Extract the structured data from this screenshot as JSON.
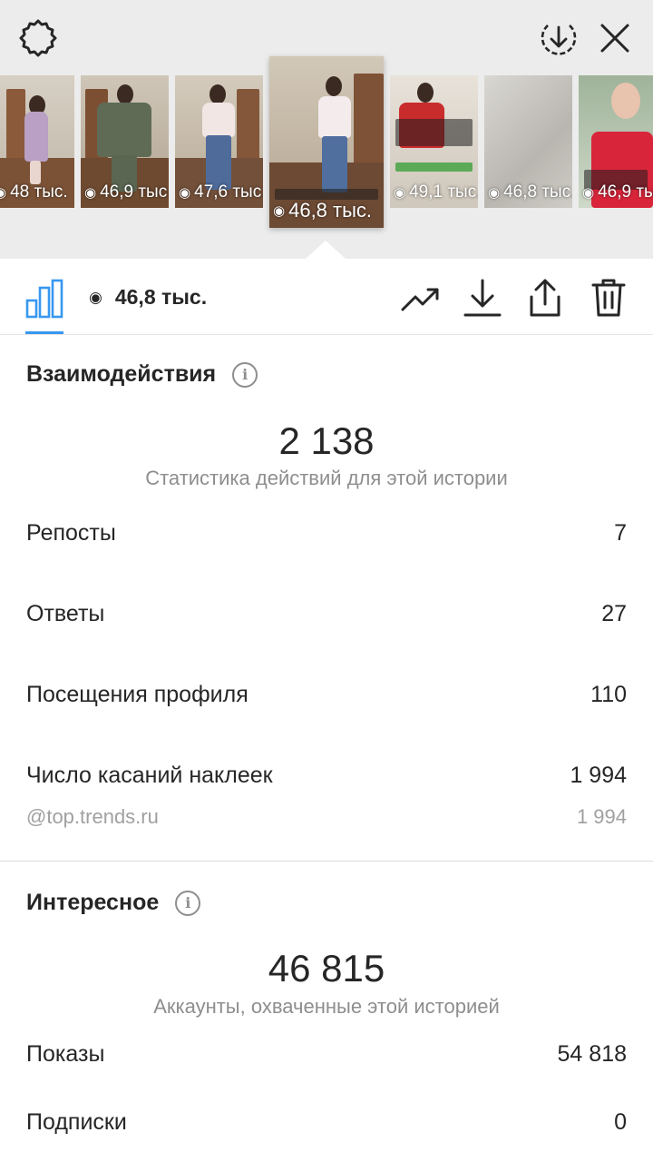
{
  "header": {
    "icons": [
      "settings-icon",
      "download-circle-icon",
      "close-icon"
    ]
  },
  "stories": [
    {
      "views": "48 тыс."
    },
    {
      "views": "46,9 тыс."
    },
    {
      "views": "47,6 тыс."
    },
    {
      "views": "46,8 тыс.",
      "selected": true
    },
    {
      "views": "49,1 тыс."
    },
    {
      "views": "46,8 тыс."
    },
    {
      "views": "46,9 тыс."
    }
  ],
  "toolbar": {
    "views": "46,8 тыс.",
    "accent": "#3897f0"
  },
  "interactions": {
    "title": "Взаимодействия",
    "total": "2 138",
    "subtitle": "Статистика действий для этой истории",
    "rows": [
      {
        "label": "Репосты",
        "value": "7"
      },
      {
        "label": "Ответы",
        "value": "27"
      },
      {
        "label": "Посещения профиля",
        "value": "110"
      },
      {
        "label": "Число касаний наклеек",
        "value": "1 994"
      }
    ],
    "sticker": {
      "label": "@top.trends.ru",
      "value": "1 994"
    }
  },
  "discovery": {
    "title": "Интересное",
    "total": "46 815",
    "subtitle": "Аккаунты, охваченные этой историей",
    "rows": [
      {
        "label": "Показы",
        "value": "54 818"
      },
      {
        "label": "Подписки",
        "value": "0"
      }
    ]
  }
}
